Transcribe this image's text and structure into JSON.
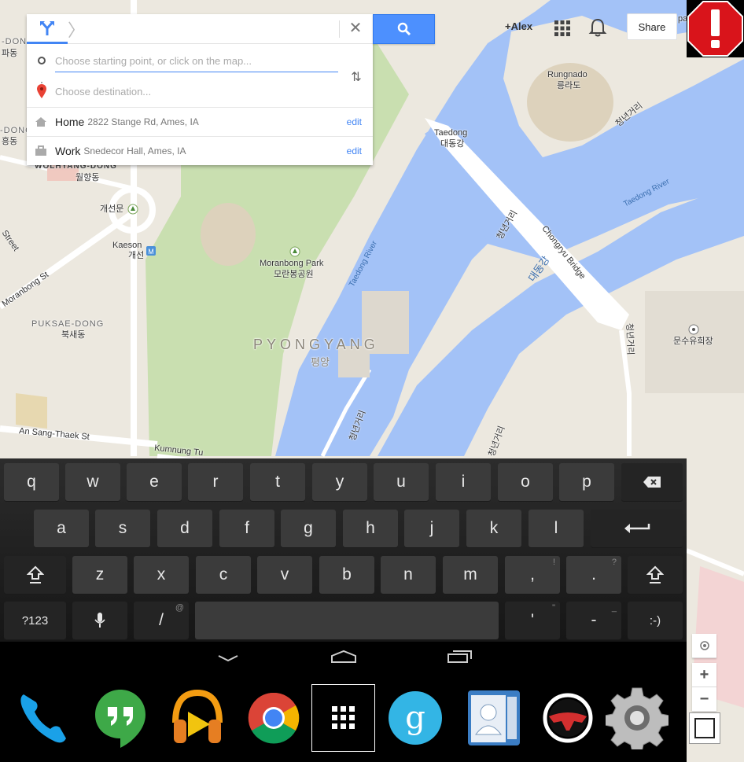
{
  "directions": {
    "start_placeholder": "Choose starting point, or click on the map...",
    "destination_placeholder": "Choose destination...",
    "saved": [
      {
        "name": "Home",
        "address": "2822 Stange Rd, Ames, IA",
        "edit_label": "edit"
      },
      {
        "name": "Work",
        "address": "Snedecor Hall, Ames, IA",
        "edit_label": "edit"
      }
    ]
  },
  "header": {
    "user": "+Alex",
    "share_label": "Share"
  },
  "map": {
    "labels": {
      "rungnado": "Rungnado",
      "rungnado_ko": "릉라도",
      "taedong": "Taedong",
      "taedong_ko": "대동강",
      "taedong_river_1": "Taedong River",
      "taedong_river_2": "Taedong River",
      "chongryu_bridge": "Chongryu Bridge",
      "daedonggang": "대동강",
      "chongnyon_1": "청년거리",
      "chongnyon_2": "청년거리",
      "chongnyon_3": "청년거리",
      "chongnyon_4": "청년거리",
      "chongnyon_5": "청년거리",
      "wolhyang": "WOLHYANG-DONG",
      "wolhyang_ko": "월향동",
      "kaeson_gate": "개선문",
      "kaeson": "Kaeson",
      "kaeson_ko": "개선",
      "moranbong_park": "Moranbong Park",
      "moranbong_park_ko": "모란봉공원",
      "pyongyang": "PYONGYANG",
      "pyongyang_ko": "평양",
      "puksae": "PUKSAE-DONG",
      "puksae_ko": "북새동",
      "moranbong_st": "Moranbong St",
      "an_sang_thaek": "An Sang-Thaek St",
      "kumnung": "Kumnung Tu",
      "munsu": "문수유희장",
      "street_left": "Street",
      "padong": "파동",
      "d_dong": "-DONG",
      "d_dong_ko": "흥동",
      "top_left_dong": "-DONG",
      "pa_top": "pa"
    },
    "colors": {
      "land": "#ece8df",
      "water": "#a3c2f7",
      "park": "#c9dfb0",
      "road": "#ffffff"
    }
  },
  "keyboard": {
    "row1": [
      "q",
      "w",
      "e",
      "r",
      "t",
      "y",
      "u",
      "i",
      "o",
      "p"
    ],
    "row2": [
      "a",
      "s",
      "d",
      "f",
      "g",
      "h",
      "j",
      "k",
      "l"
    ],
    "row3": [
      "z",
      "x",
      "c",
      "v",
      "b",
      "n",
      "m",
      ",",
      "."
    ],
    "row3_hints": [
      "",
      "",
      "",
      "",
      "",
      "",
      "",
      "!",
      "?"
    ],
    "row4": {
      "symbols": "?123",
      "slash": "/",
      "slash_hint": "@",
      "apostrophe": "'",
      "apostrophe_hint": "\"",
      "dash": "-",
      "dash_hint": "_",
      "smiley": ":-)"
    }
  },
  "dock": {
    "apps": [
      "phone-icon",
      "hangouts-icon",
      "play-music-icon",
      "chrome-icon",
      "app-drawer-icon",
      "google-search-icon",
      "contacts-icon",
      "car-home-icon",
      "settings-icon"
    ]
  }
}
